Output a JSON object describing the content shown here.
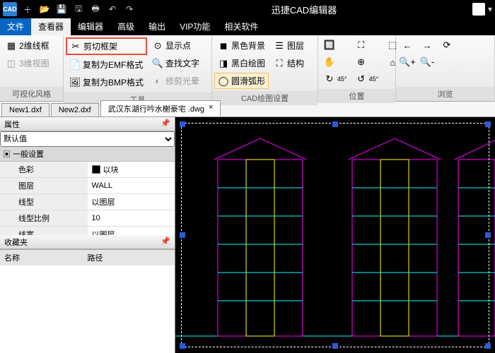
{
  "app": {
    "title": "迅捷CAD编辑器"
  },
  "menu": {
    "file": "文件",
    "viewer": "查看器",
    "editor": "编辑器",
    "advanced": "高级",
    "output": "输出",
    "vip": "VIP功能",
    "related": "相关软件"
  },
  "ribbon": {
    "g1": {
      "title": "可视化风格",
      "btn2d": "2维线框",
      "btn3d": "3维视图"
    },
    "g2": {
      "title": "工具",
      "clip": "剪切框架",
      "emf": "复制为EMF格式",
      "bmp": "复制为BMP格式",
      "showpt": "显示点",
      "findtxt": "查找文字",
      "trim": "修剪光晕"
    },
    "g3": {
      "title": "CAD绘图设置",
      "blackbg": "黑色背景",
      "bwplot": "黑白绘图",
      "arc": "圆滑弧形",
      "layer": "图层",
      "struct": "结构"
    },
    "g4": {
      "title": "位置"
    },
    "g5": {
      "title": "浏览"
    }
  },
  "tabs": {
    "t1": "New1.dxf",
    "t2": "New2.dxf",
    "t3": "武汉东湖行吟水榭豪宅 .dwg"
  },
  "props": {
    "title": "属性",
    "default": "默认值",
    "section": "一般设置",
    "rows": [
      {
        "k": "色彩",
        "v": "以块",
        "swatch": true
      },
      {
        "k": "图层",
        "v": "WALL"
      },
      {
        "k": "线型",
        "v": "以图层"
      },
      {
        "k": "线型比例",
        "v": "10"
      },
      {
        "k": "线宽",
        "v": "以图层"
      }
    ],
    "favTitle": "收藏夹",
    "favName": "名称",
    "favPath": "路径"
  }
}
